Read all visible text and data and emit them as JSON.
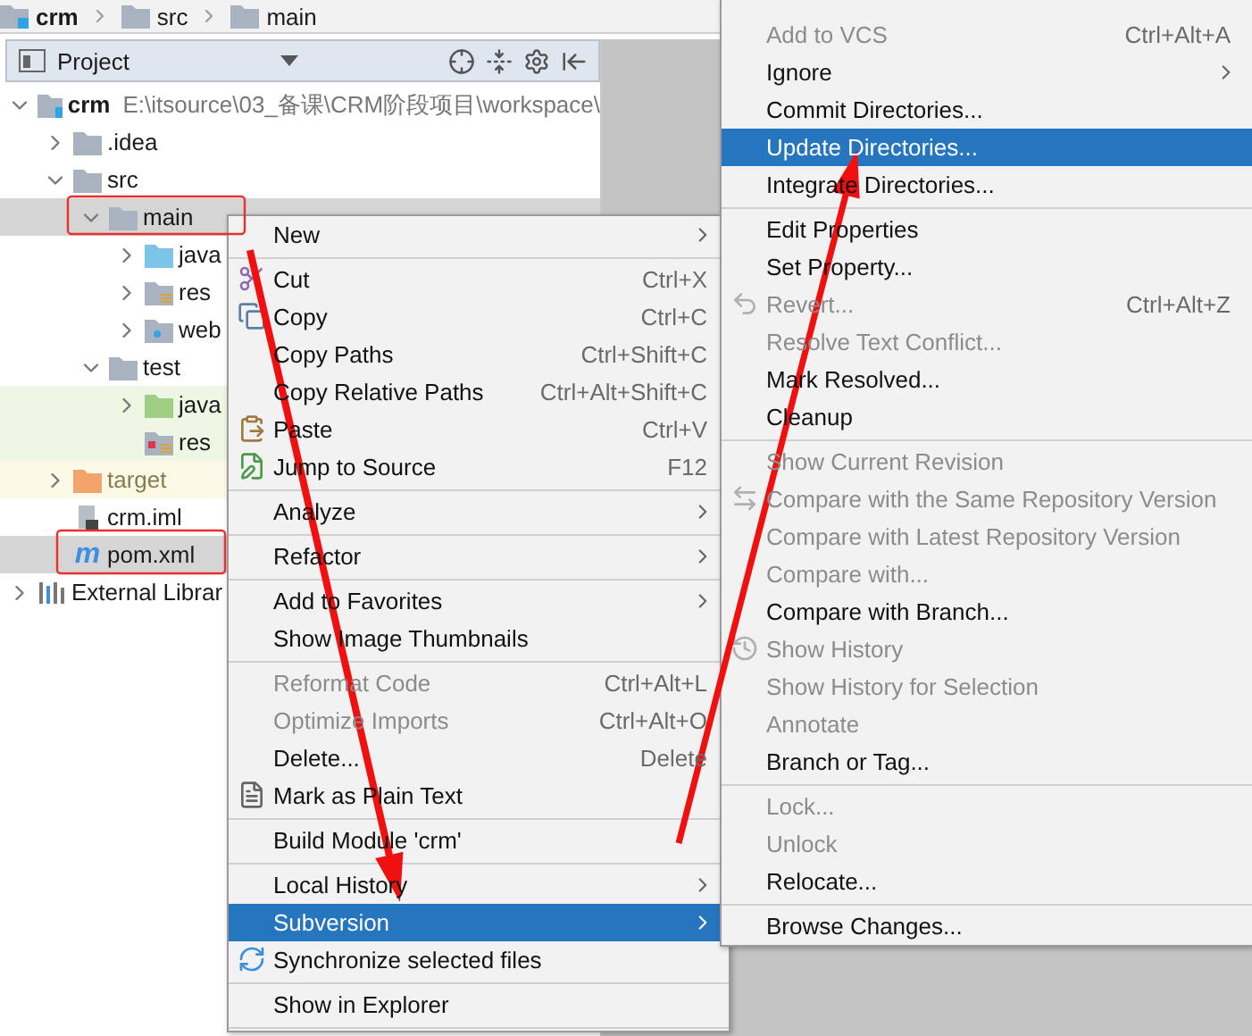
{
  "breadcrumbs": [
    {
      "label": "crm",
      "kind": "module"
    },
    {
      "label": "src",
      "kind": "folder"
    },
    {
      "label": "main",
      "kind": "folder"
    }
  ],
  "project_panel": {
    "title": "Project"
  },
  "tree": [
    {
      "label": "crm",
      "kind": "module",
      "hint": "E:\\itsource\\03_备课\\CRM阶段项目\\workspace\\",
      "expanded": true,
      "selected": false,
      "children": [
        {
          "label": ".idea",
          "kind": "folder",
          "expanded": false,
          "selected": false
        },
        {
          "label": "src",
          "kind": "folder",
          "expanded": true,
          "selected": false,
          "children": [
            {
              "label": "main",
              "kind": "folder",
              "expanded": true,
              "selected": true,
              "children": [
                {
                  "label": "java",
                  "kind": "source",
                  "expanded": false,
                  "selected": false
                },
                {
                  "label": "res",
                  "kind": "resources",
                  "expanded": false,
                  "selected": false
                },
                {
                  "label": "web",
                  "kind": "web",
                  "expanded": false,
                  "selected": false
                }
              ]
            },
            {
              "label": "test",
              "kind": "folder",
              "expanded": true,
              "selected": false,
              "children": [
                {
                  "label": "java",
                  "kind": "test_source",
                  "expanded": false,
                  "selected": false
                },
                {
                  "label": "res",
                  "kind": "test_resources",
                  "selected": false
                }
              ]
            }
          ]
        },
        {
          "label": "target",
          "kind": "excluded",
          "expanded": false,
          "selected": false
        },
        {
          "label": "crm.iml",
          "kind": "iml",
          "selected": false
        },
        {
          "label": "pom.xml",
          "kind": "maven",
          "badge": "m",
          "selected": true
        }
      ]
    },
    {
      "label": "External Librar",
      "kind": "library",
      "expanded": false,
      "selected": false
    }
  ],
  "context_menu": {
    "items": [
      {
        "kind": "plain",
        "label": "New",
        "submenu": true,
        "disabled": false,
        "selected": false
      },
      {
        "kind": "separator"
      },
      {
        "kind": "scissors",
        "label": "Cut",
        "shortcut": "Ctrl+X",
        "submenu": false,
        "disabled": false,
        "selected": false
      },
      {
        "kind": "copy",
        "label": "Copy",
        "shortcut": "Ctrl+C",
        "submenu": false,
        "disabled": false,
        "selected": false
      },
      {
        "kind": "plain",
        "label": "Copy Paths",
        "shortcut": "Ctrl+Shift+C",
        "submenu": false,
        "disabled": false,
        "selected": false
      },
      {
        "kind": "plain",
        "label": "Copy Relative Paths",
        "shortcut": "Ctrl+Alt+Shift+C",
        "submenu": false,
        "disabled": false,
        "selected": false
      },
      {
        "kind": "paste",
        "label": "Paste",
        "shortcut": "Ctrl+V",
        "submenu": false,
        "disabled": false,
        "selected": false
      },
      {
        "kind": "jump",
        "label": "Jump to Source",
        "shortcut": "F12",
        "submenu": false,
        "disabled": false,
        "selected": false
      },
      {
        "kind": "separator"
      },
      {
        "kind": "plain",
        "label": "Analyze",
        "submenu": true,
        "disabled": false,
        "selected": false
      },
      {
        "kind": "separator"
      },
      {
        "kind": "plain",
        "label": "Refactor",
        "submenu": true,
        "disabled": false,
        "selected": false
      },
      {
        "kind": "separator"
      },
      {
        "kind": "plain",
        "label": "Add to Favorites",
        "submenu": true,
        "disabled": false,
        "selected": false
      },
      {
        "kind": "plain",
        "label": "Show Image Thumbnails",
        "submenu": false,
        "disabled": false,
        "selected": false
      },
      {
        "kind": "separator"
      },
      {
        "kind": "plain",
        "label": "Reformat Code",
        "shortcut": "Ctrl+Alt+L",
        "submenu": false,
        "disabled": true,
        "selected": false
      },
      {
        "kind": "plain",
        "label": "Optimize Imports",
        "shortcut": "Ctrl+Alt+O",
        "submenu": false,
        "disabled": true,
        "selected": false
      },
      {
        "kind": "plain",
        "label": "Delete...",
        "shortcut": "Delete",
        "submenu": false,
        "disabled": false,
        "selected": false
      },
      {
        "kind": "plaintext",
        "label": "Mark as Plain Text",
        "submenu": false,
        "disabled": false,
        "selected": false
      },
      {
        "kind": "separator"
      },
      {
        "kind": "plain",
        "label": "Build Module 'crm'",
        "submenu": false,
        "disabled": false,
        "selected": false
      },
      {
        "kind": "separator"
      },
      {
        "kind": "plain",
        "label": "Local History",
        "submenu": true,
        "disabled": false,
        "selected": false
      },
      {
        "kind": "plain",
        "label": "Subversion",
        "submenu": true,
        "disabled": false,
        "selected": true
      },
      {
        "kind": "sync",
        "label": "Synchronize selected files",
        "submenu": false,
        "disabled": false,
        "selected": false
      },
      {
        "kind": "separator"
      },
      {
        "kind": "plain",
        "label": "Show in Explorer",
        "submenu": false,
        "disabled": false,
        "selected": false
      },
      {
        "kind": "separator"
      }
    ]
  },
  "submenu": {
    "items": [
      {
        "kind": "plain",
        "label": "Add to VCS",
        "shortcut": "Ctrl+Alt+A",
        "submenu": false,
        "disabled": true,
        "selected": false
      },
      {
        "kind": "plain",
        "label": "Ignore",
        "submenu": true,
        "disabled": false,
        "selected": false
      },
      {
        "kind": "plain",
        "label": "Commit Directories...",
        "submenu": false,
        "disabled": false,
        "selected": false
      },
      {
        "kind": "plain",
        "label": "Update Directories...",
        "submenu": false,
        "disabled": false,
        "selected": true
      },
      {
        "kind": "plain",
        "label": "Integrate Directories...",
        "submenu": false,
        "disabled": false,
        "selected": false
      },
      {
        "kind": "separator"
      },
      {
        "kind": "plain",
        "label": "Edit Properties",
        "submenu": false,
        "disabled": false,
        "selected": false
      },
      {
        "kind": "plain",
        "label": "Set Property...",
        "submenu": false,
        "disabled": false,
        "selected": false
      },
      {
        "kind": "revert",
        "label": "Revert...",
        "shortcut": "Ctrl+Alt+Z",
        "submenu": false,
        "disabled": true,
        "selected": false
      },
      {
        "kind": "plain",
        "label": "Resolve Text Conflict...",
        "submenu": false,
        "disabled": true,
        "selected": false
      },
      {
        "kind": "plain",
        "label": "Mark Resolved...",
        "submenu": false,
        "disabled": false,
        "selected": false
      },
      {
        "kind": "plain",
        "label": "Cleanup",
        "submenu": false,
        "disabled": false,
        "selected": false
      },
      {
        "kind": "separator"
      },
      {
        "kind": "plain",
        "label": "Show Current Revision",
        "submenu": false,
        "disabled": true,
        "selected": false
      },
      {
        "kind": "compare",
        "label": "Compare with the Same Repository Version",
        "submenu": false,
        "disabled": true,
        "selected": false
      },
      {
        "kind": "plain",
        "label": "Compare with Latest Repository Version",
        "submenu": false,
        "disabled": true,
        "selected": false
      },
      {
        "kind": "plain",
        "label": "Compare with...",
        "submenu": false,
        "disabled": true,
        "selected": false
      },
      {
        "kind": "plain",
        "label": "Compare with Branch...",
        "submenu": false,
        "disabled": false,
        "selected": false
      },
      {
        "kind": "history",
        "label": "Show History",
        "submenu": false,
        "disabled": true,
        "selected": false
      },
      {
        "kind": "plain",
        "label": "Show History for Selection",
        "submenu": false,
        "disabled": true,
        "selected": false
      },
      {
        "kind": "plain",
        "label": "Annotate",
        "submenu": false,
        "disabled": true,
        "selected": false
      },
      {
        "kind": "plain",
        "label": "Branch or Tag...",
        "submenu": false,
        "disabled": false,
        "selected": false
      },
      {
        "kind": "separator"
      },
      {
        "kind": "plain",
        "label": "Lock...",
        "submenu": false,
        "disabled": true,
        "selected": false
      },
      {
        "kind": "plain",
        "label": "Unlock",
        "submenu": false,
        "disabled": true,
        "selected": false
      },
      {
        "kind": "plain",
        "label": "Relocate...",
        "submenu": false,
        "disabled": false,
        "selected": false
      },
      {
        "kind": "separator"
      },
      {
        "kind": "plain",
        "label": "Browse Changes...",
        "submenu": false,
        "disabled": false,
        "selected": false
      }
    ]
  }
}
